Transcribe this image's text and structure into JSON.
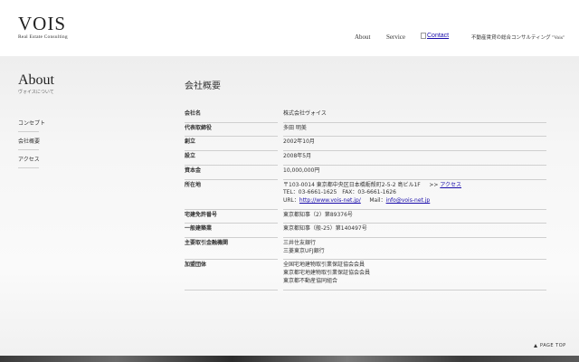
{
  "header": {
    "logo_main": "VOIS",
    "logo_sub": "Real Estate Consulting",
    "nav": [
      {
        "label": "About"
      },
      {
        "label": "Service"
      }
    ],
    "contact_label": "Contact",
    "tagline": "不動産賃貸の総合コンサルティング \"Vois\""
  },
  "sidebar": {
    "title": "About",
    "subtitle": "ヴォイスについて",
    "links": [
      {
        "label": "コンセプト"
      },
      {
        "label": "会社概要"
      },
      {
        "label": "アクセス"
      }
    ]
  },
  "main": {
    "title": "会社概要",
    "rows": [
      {
        "label": "会社名",
        "lines": [
          "株式会社ヴォイス"
        ]
      },
      {
        "label": "代表取締役",
        "lines": [
          "多田 明美"
        ]
      },
      {
        "label": "創立",
        "lines": [
          "2002年10月"
        ]
      },
      {
        "label": "設立",
        "lines": [
          "2008年5月"
        ]
      },
      {
        "label": "資本金",
        "lines": [
          "10,000,000円"
        ]
      },
      {
        "label": "所在地",
        "address": "〒103-0014 東京都中央区日本橋蛎殻町2-5-2 島ビル1F",
        "access_prefix": ">>",
        "access_link": "アクセス",
        "tel_fax": "TEL：03-6661-1625　FAX：03-6661-1626",
        "url_label": "URL：",
        "url": "http://www.vois-net.jp/",
        "mail_label": "Mail：",
        "mail": "info@vois-net.jp"
      },
      {
        "label": "宅建免許番号",
        "lines": [
          "東京都知事（2）第89376号"
        ]
      },
      {
        "label": "一般建築業",
        "lines": [
          "東京都知事（般-25）第140497号"
        ]
      },
      {
        "label": "主要取引金融機関",
        "lines": [
          "三井住友銀行",
          "三菱東京UFJ銀行"
        ]
      },
      {
        "label": "加盟団体",
        "lines": [
          "全国宅地建物取引業保証協会会員",
          "東京都宅地建物取引業保証協会会員",
          "東京都不動産協同組合"
        ]
      }
    ]
  },
  "footer": {
    "page_top": "PAGE TOP"
  }
}
